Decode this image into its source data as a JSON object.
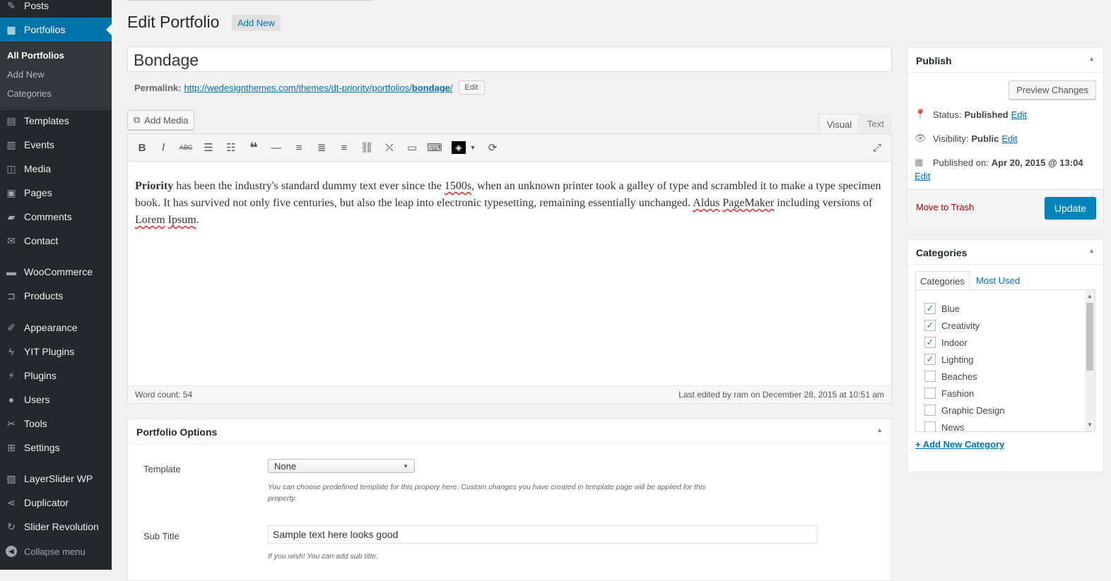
{
  "sidebar": {
    "items": [
      {
        "label": "Posts",
        "icon": "pin-icon"
      },
      {
        "label": "Portfolios",
        "icon": "portfolio-icon"
      },
      {
        "label": "Templates",
        "icon": "document-icon"
      },
      {
        "label": "Events",
        "icon": "calendar-icon"
      },
      {
        "label": "Media",
        "icon": "media-icon"
      },
      {
        "label": "Pages",
        "icon": "pages-icon"
      },
      {
        "label": "Comments",
        "icon": "comment-icon"
      },
      {
        "label": "Contact",
        "icon": "mail-icon"
      },
      {
        "label": "WooCommerce",
        "icon": "woo-icon"
      },
      {
        "label": "Products",
        "icon": "cart-icon"
      },
      {
        "label": "Appearance",
        "icon": "brush-icon"
      },
      {
        "label": "YIT Plugins",
        "icon": "plug-icon"
      },
      {
        "label": "Plugins",
        "icon": "plugins-icon"
      },
      {
        "label": "Users",
        "icon": "user-icon"
      },
      {
        "label": "Tools",
        "icon": "wrench-icon"
      },
      {
        "label": "Settings",
        "icon": "settings-icon"
      },
      {
        "label": "LayerSlider WP",
        "icon": "layers-icon"
      },
      {
        "label": "Duplicator",
        "icon": "share-icon"
      },
      {
        "label": "Slider Revolution",
        "icon": "refresh-icon"
      }
    ],
    "submenu": [
      "All Portfolios",
      "Add New",
      "Categories"
    ],
    "collapse": "Collapse menu"
  },
  "header": {
    "title": "Edit Portfolio",
    "add_new": "Add New"
  },
  "post": {
    "title": "Bondage",
    "permalink_label": "Permalink:",
    "permalink_base": "http://wedesignthemes.com/themes/dt-priority/portfolios/",
    "permalink_slug": "bondage",
    "permalink_end": "/",
    "edit_btn": "Edit"
  },
  "editor": {
    "add_media": "Add Media",
    "tab_visual": "Visual",
    "tab_text": "Text",
    "content_bold": "Priority",
    "content_1": " has been the industry's standard dummy text ever since the ",
    "content_1500s": "1500s",
    "content_2": ", when an unknown printer took a galley of type and scrambled it to make a type specimen book. It has survived not only five centuries, but also the leap into electronic typesetting, remaining essentially unchanged. ",
    "content_aldus": "Aldus",
    "content_space": " ",
    "content_pagemaker": "PageMaker",
    "content_3": " including versions of ",
    "content_lorem": "Lorem",
    "content_ipsum": "Ipsum",
    "content_end": ".",
    "word_count": "Word count: 54",
    "last_edited": "Last edited by ram on December 28, 2015 at 10:51 am"
  },
  "portfolio_options": {
    "title": "Portfolio Options",
    "template_label": "Template",
    "template_value": "None",
    "template_desc": "You can choose predefined template for this propery here. Custom changes you have created in template page will be applied for this property.",
    "subtitle_label": "Sub Title",
    "subtitle_value": "Sample text here looks good",
    "subtitle_desc": "If you wish! You can add sub title."
  },
  "publish": {
    "title": "Publish",
    "preview": "Preview Changes",
    "status_label": "Status:",
    "status_value": "Published",
    "visibility_label": "Visibility:",
    "visibility_value": "Public",
    "published_label": "Published on:",
    "published_value": "Apr 20, 2015 @ 13:04",
    "edit": "Edit",
    "trash": "Move to Trash",
    "update": "Update"
  },
  "categories": {
    "title": "Categories",
    "tab_all": "Categories",
    "tab_used": "Most Used",
    "items": [
      {
        "label": "Blue",
        "checked": "✓"
      },
      {
        "label": "Creativity",
        "checked": "✓"
      },
      {
        "label": "Indoor",
        "checked": "✓"
      },
      {
        "label": "Lighting",
        "checked": "✓"
      },
      {
        "label": "Beaches",
        "checked": ""
      },
      {
        "label": "Fashion",
        "checked": ""
      },
      {
        "label": "Graphic Design",
        "checked": ""
      },
      {
        "label": "News",
        "checked": ""
      }
    ],
    "add_new": "+ Add New Category"
  }
}
